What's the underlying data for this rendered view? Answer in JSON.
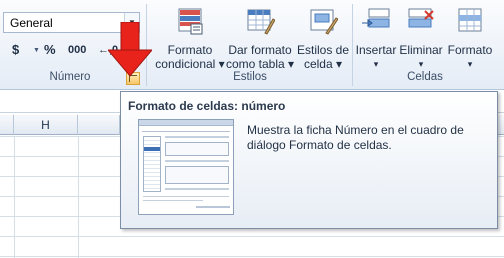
{
  "ribbon": {
    "number_group": {
      "format_value": "General",
      "symbols": [
        "$",
        "%",
        "000",
        "←,0"
      ],
      "label": "Número"
    },
    "styles_group": {
      "buttons": [
        {
          "label_line1": "Formato",
          "label_line2": "condicional",
          "icon": "conditional-format-icon"
        },
        {
          "label_line1": "Dar formato",
          "label_line2": "como tabla",
          "icon": "format-as-table-icon"
        },
        {
          "label_line1": "Estilos de",
          "label_line2": "celda",
          "icon": "cell-styles-icon"
        }
      ],
      "label": "Estilos"
    },
    "cells_group": {
      "buttons": [
        {
          "label": "Insertar",
          "icon": "insert-cells-icon"
        },
        {
          "label": "Eliminar",
          "icon": "delete-cells-icon"
        },
        {
          "label": "Formato",
          "icon": "format-cells-icon"
        }
      ],
      "label": "Celdas"
    }
  },
  "grid": {
    "column_header": "H"
  },
  "tooltip": {
    "title": "Formato de celdas: número",
    "description": "Muestra la ficha Número en el cuadro de diálogo Formato de celdas."
  },
  "colors": {
    "accent_red": "#e8231c",
    "launcher_gold": "#f7c566"
  }
}
